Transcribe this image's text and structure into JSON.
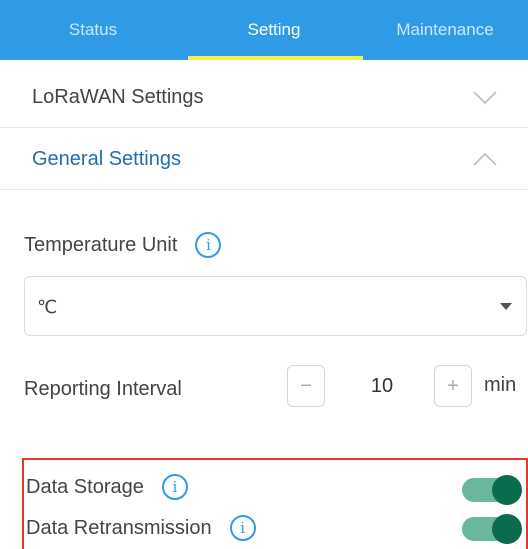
{
  "tabs": [
    {
      "label": "Status"
    },
    {
      "label": "Setting",
      "active": true
    },
    {
      "label": "Maintenance"
    }
  ],
  "sections": {
    "lorawan": {
      "label": "LoRaWAN Settings",
      "icon": "chevron-down-icon"
    },
    "general": {
      "label": "General Settings",
      "icon": "chevron-up-icon"
    }
  },
  "temperature_unit": {
    "label": "Temperature Unit",
    "value": "℃",
    "info_icon": "i"
  },
  "reporting_interval": {
    "label": "Reporting Interval",
    "minus": "−",
    "value": "10",
    "plus": "+",
    "unit": "min"
  },
  "data_storage": {
    "label": "Data Storage",
    "info_icon": "i",
    "enabled": true
  },
  "data_retransmission": {
    "label": "Data Retransmission",
    "info_icon": "i",
    "enabled": true
  },
  "colors": {
    "tab_bar": "#2f9be6",
    "tab_indicator": "#f4ef4a",
    "section_active": "#1f6fb0",
    "toggle_on_track": "#6ab89c",
    "toggle_on_knob": "#0b6b4f",
    "highlight_border": "#e8362b"
  }
}
